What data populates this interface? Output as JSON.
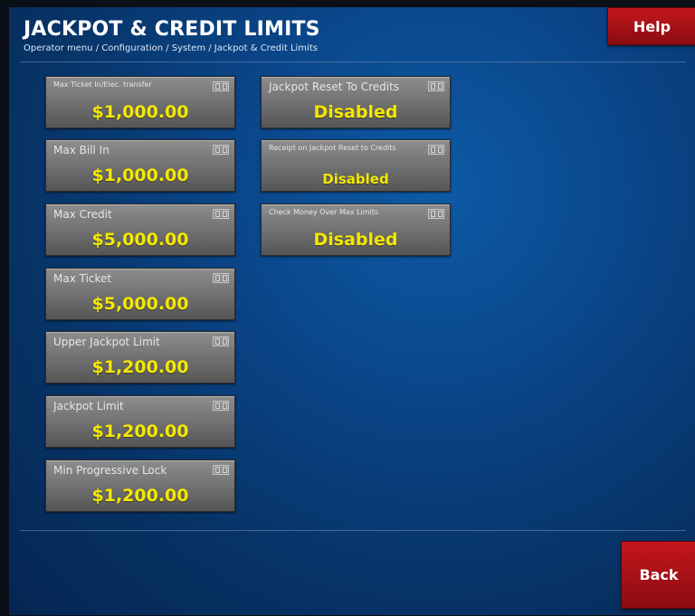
{
  "header": {
    "title": "JACKPOT & CREDIT LIMITS",
    "breadcrumb": "Operator menu / Configuration / System / Jackpot & Credit Limits"
  },
  "buttons": {
    "help": "Help",
    "back": "Back"
  },
  "left_column": [
    {
      "label": "Max Ticket In/Elec. transfer",
      "value": "$1,000.00"
    },
    {
      "label": "Max Bill In",
      "value": "$1,000.00"
    },
    {
      "label": "Max Credit",
      "value": "$5,000.00"
    },
    {
      "label": "Max Ticket",
      "value": "$5,000.00"
    },
    {
      "label": "Upper Jackpot Limit",
      "value": "$1,200.00"
    },
    {
      "label": "Jackpot Limit",
      "value": "$1,200.00"
    },
    {
      "label": "Min Progressive Lock",
      "value": "$1,200.00"
    }
  ],
  "right_column": [
    {
      "label": "Jackpot Reset To Credits",
      "value": "Disabled"
    },
    {
      "label": "Receipt on Jackpot Reset to Credits",
      "value": "Disabled"
    },
    {
      "label": "Check Money Over Max Limits",
      "value": "Disabled"
    }
  ],
  "icons": {
    "tile_icon": "keypad-icon"
  },
  "colors": {
    "value_text": "#f4e800",
    "button_red": "#c4171c",
    "background_blue": "#0a4588"
  }
}
